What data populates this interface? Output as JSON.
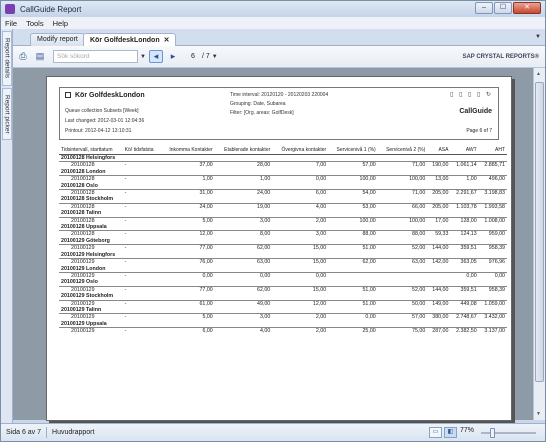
{
  "window": {
    "title": "CallGuide Report",
    "minimize": "–",
    "maximize": "☐",
    "close": "✕"
  },
  "menu": [
    "File",
    "Tools",
    "Help"
  ],
  "sidebar": {
    "tab1": "Report details",
    "tab2": "Report picker"
  },
  "tabs": [
    {
      "label": "Modify report"
    },
    {
      "label": "Kör GolfdeskLondon",
      "close": "✕"
    }
  ],
  "tab_menu": "▼",
  "toolbar": {
    "search_placeholder": "Sök sökord",
    "page_current": "6",
    "page_total": "/ 7",
    "sap_label": "SAP CRYSTAL REPORTS®"
  },
  "report": {
    "title": "Kör GolfdeskLondon",
    "queue": "Queue collection Subsets [Week]",
    "last_changed": "Last changed: 2012-03-01 12:04:36",
    "printout": "Printout: 2012-04-12 13:10:31",
    "time_interval": "Time interval: 20120120 - 20120203 220004",
    "grouping": "Grouping: Date, Subarea",
    "filter": "Filter: [Org. areas: GolfDesk]",
    "brand": "CallGuide",
    "page": "Page 6 of 7",
    "header_icons": "▯ ▯ ▯ ▯ ↻",
    "columns": [
      "Tidsintervall, starttatum",
      "Kö/ tidsfatsta",
      "Inkomma Kontakter",
      "Etablerade kontakter",
      "Övergivna kontakter",
      "Servicenivå 1 (%)",
      "Servicenivå 2 (%)",
      "ASA",
      "AWT",
      "AHT"
    ],
    "groups": [
      {
        "name": "20100128 Helsingfors",
        "row": [
          "20100128",
          "-",
          "37,00",
          "28,00",
          "7,00",
          "57,00",
          "71,00",
          "190,00",
          "1.061,14",
          "2.885,71"
        ]
      },
      {
        "name": "20100128 London",
        "row": [
          "20100128",
          "-",
          "1,00",
          "1,00",
          "0,00",
          "100,00",
          "100,00",
          "13,00",
          "1,00",
          "496,00"
        ]
      },
      {
        "name": "20100128 Oslo",
        "row": [
          "20100128",
          "-",
          "31,00",
          "24,00",
          "6,00",
          "54,00",
          "71,00",
          "205,00",
          "2.291,67",
          "3.198,83"
        ]
      },
      {
        "name": "20100128 Stockholm",
        "row": [
          "20100128",
          "-",
          "24,00",
          "19,00",
          "4,00",
          "53,00",
          "66,00",
          "205,00",
          "1.103,78",
          "1.993,58"
        ]
      },
      {
        "name": "20100128 Talinn",
        "row": [
          "20100128",
          "-",
          "5,00",
          "3,00",
          "2,00",
          "100,00",
          "100,00",
          "17,00",
          "128,00",
          "1.008,00"
        ]
      },
      {
        "name": "20100128 Uppsala",
        "row": [
          "20100128",
          "-",
          "12,00",
          "8,00",
          "3,00",
          "88,00",
          "88,00",
          "59,33",
          "124,13",
          "959,00"
        ]
      },
      {
        "name": "20100129 Göteborg",
        "row": [
          "20100129",
          "-",
          "77,00",
          "62,00",
          "15,00",
          "51,00",
          "52,00",
          "144,00",
          "359,51",
          "958,39"
        ]
      },
      {
        "name": "20100129 Helsingfors",
        "row": [
          "20100129",
          "-",
          "76,00",
          "63,00",
          "15,00",
          "62,00",
          "63,00",
          "142,00",
          "363,05",
          "976,96"
        ]
      },
      {
        "name": "20100129 London",
        "row": [
          "20100129",
          "-",
          "0,00",
          "0,00",
          "0,00",
          "",
          "",
          "",
          "0,00",
          "0,00"
        ]
      },
      {
        "name": "20100129 Oslo",
        "row": [
          "20100129",
          "-",
          "77,00",
          "62,00",
          "15,00",
          "51,00",
          "52,00",
          "144,00",
          "359,51",
          "958,39"
        ]
      },
      {
        "name": "20100129 Stockholm",
        "row": [
          "20100129",
          "-",
          "61,00",
          "49,00",
          "12,00",
          "51,00",
          "50,00",
          "149,00",
          "449,08",
          "1.059,00"
        ]
      },
      {
        "name": "20100129 Talinn",
        "row": [
          "20100129",
          "-",
          "5,00",
          "3,00",
          "2,00",
          "0,00",
          "57,00",
          "380,00",
          "2.748,67",
          "3.432,00"
        ]
      },
      {
        "name": "20100129 Uppsala",
        "row": [
          "20100129",
          "-",
          "6,00",
          "4,00",
          "2,00",
          "25,00",
          "75,00",
          "287,00",
          "2.382,50",
          "3.137,00"
        ]
      }
    ]
  },
  "status": {
    "page": "Sida 6 av 7",
    "section": "Huvudrapport",
    "zoom": "77%",
    "zoom_fraction": 0.77
  }
}
